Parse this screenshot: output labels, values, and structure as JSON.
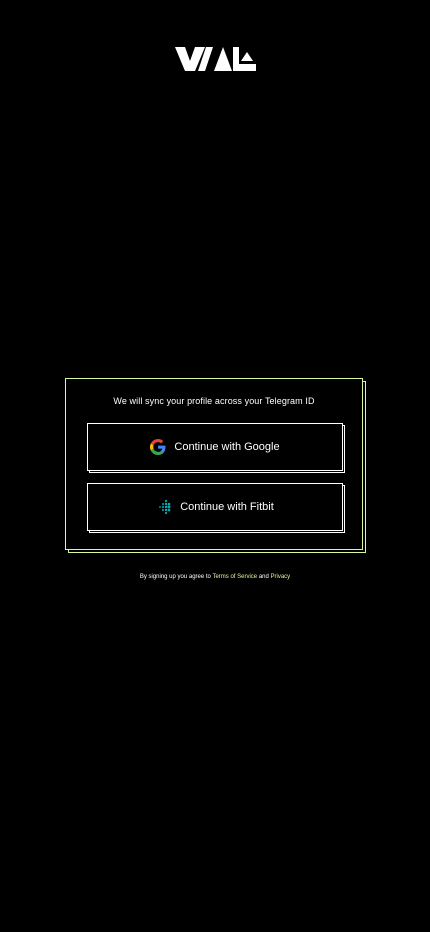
{
  "brand": {
    "logo_icon": "vial-wordmark-logo",
    "accent_color": "#d9f99d"
  },
  "signin_card": {
    "caption": "We will  sync your profile across your Telegram ID",
    "google_button": {
      "label": "Continue with Google",
      "icon": "google-icon"
    },
    "fitbit_button": {
      "label": "Continue with Fitbit",
      "icon": "fitbit-icon"
    }
  },
  "legal": {
    "prefix": "By signing up you agree to",
    "terms_link": "Terms of Service",
    "conjunction": "and",
    "privacy_link": "Privacy"
  }
}
